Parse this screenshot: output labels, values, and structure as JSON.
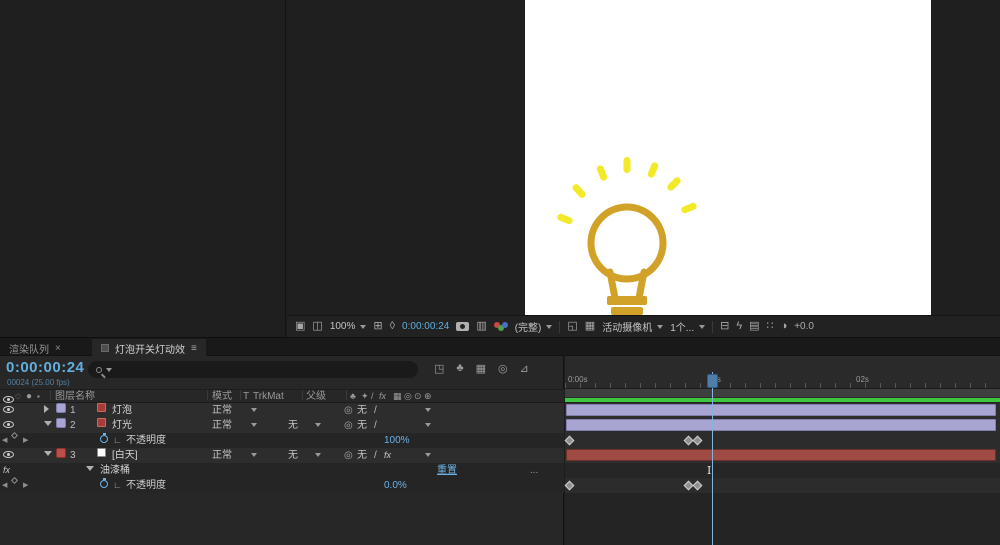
{
  "viewer": {
    "toolbar": {
      "zoom": "100%",
      "timecode": "0:00:00:24",
      "resolution": "(完整)",
      "camera": "活动摄像机",
      "view_layout": "1个...",
      "exposure": "+0.0"
    }
  },
  "timeline": {
    "tab_render_queue": "渲染队列",
    "tab_comp": "灯泡开关灯动效",
    "current_time": "0:00:00:24",
    "frame_info": "00024 (25.00 fps)",
    "search_value": "",
    "columns": {
      "layer_name": "图层名称",
      "mode": "模式",
      "t": "T",
      "trkmat": "TrkMat",
      "parent": "父级"
    },
    "rows": [
      {
        "num": "1",
        "name": "灯泡",
        "mode": "正常",
        "parent": "无"
      },
      {
        "num": "2",
        "name": "灯光",
        "mode": "正常",
        "trkmat": "无",
        "parent": "无"
      },
      {
        "name": "不透明度",
        "value": "100%"
      },
      {
        "num": "3",
        "name": "[白天]",
        "mode": "正常",
        "trkmat": "无",
        "parent": "无"
      },
      {
        "name": "油漆桶",
        "reset": "重置",
        "more": "..."
      },
      {
        "name": "不透明度",
        "value": "0.0%"
      }
    ],
    "ruler_labels": [
      "0:00s",
      "01s",
      "02s"
    ],
    "cursor_glyph": "I"
  },
  "icons": {
    "always_preview": "▣",
    "primary_viewer": "◫",
    "grid_guides": "⊞",
    "mask_paths": "◊",
    "snapshot_show": "▥",
    "region_of_interest": "◱",
    "transparency_grid": "▦",
    "pixel_aspect": "⊟",
    "fast_preview": "ϟ",
    "timeline_btn": "▤",
    "flowchart": "∷",
    "exposure_reset": "◑",
    "mini_flowchart": "◳",
    "shy": "♣",
    "frame_blend": "▦",
    "motion_blur": "◎",
    "adjustment": "⊙",
    "threed": "⊕",
    "collapse": "✦",
    "quality": "/",
    "fx": "fx",
    "graph": "∟",
    "pickwhip": "◎",
    "prev_key": "◀",
    "next_key": "▶",
    "audio": "◌",
    "solo": "●",
    "lock": "▪",
    "tab_menu": "≡",
    "tab_close": "×",
    "more": "...",
    "graph_editor": "⊿"
  },
  "colors": {
    "accent_blue": "#6db3e8",
    "lavender_bar": "#a9a5d3",
    "red_bar": "#a04a44",
    "render_green": "#3ec63e",
    "ray_yellow": "#f2ea28",
    "bulb_gold": "#d2a128"
  }
}
